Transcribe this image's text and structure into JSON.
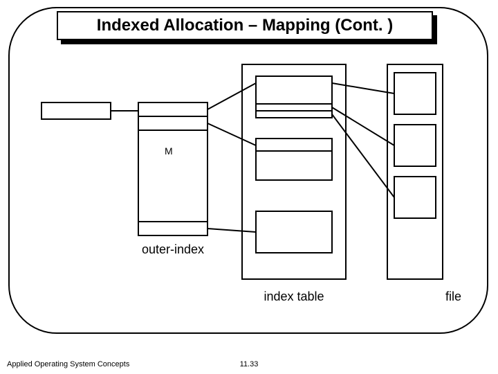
{
  "title": "Indexed Allocation – Mapping (Cont. )",
  "labels": {
    "outer_index": "outer-index",
    "index_table": "index table",
    "file": "file"
  },
  "symbol": "M",
  "footer": "Applied Operating System Concepts",
  "slide_number": "11.33"
}
